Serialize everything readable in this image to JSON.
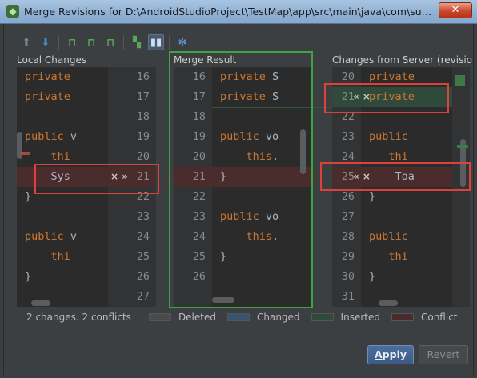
{
  "window": {
    "title": "Merge Revisions for D:\\AndroidStudioProject\\TestMap\\app\\src\\main\\java\\com\\summerxia\\tes...",
    "close_symbol": "✕"
  },
  "toolbar": {
    "icons": [
      "up-arrow-icon",
      "down-arrow-icon",
      "apply-left-icon",
      "apply-all-icon",
      "apply-right-icon",
      "magic-resolve-icon",
      "side-by-side-icon",
      "settings-gear-icon"
    ]
  },
  "panels": {
    "left_header": "Local Changes",
    "center_header": "Merge Result",
    "right_header": "Changes from Server (revisio..."
  },
  "left": {
    "line_numbers": [
      "16",
      "17",
      "18",
      "19",
      "20",
      "21",
      "22",
      "23",
      "24",
      "25",
      "26",
      "27"
    ],
    "code": [
      {
        "kw": "private",
        "txt": ""
      },
      {
        "kw": "private",
        "txt": ""
      },
      {
        "kw": "",
        "txt": ""
      },
      {
        "kw": "public",
        "txt": " v"
      },
      {
        "kw": "    thi",
        "txt": ""
      },
      {
        "kw": "",
        "txt": "    Sys"
      },
      {
        "kw": "",
        "txt": "}"
      },
      {
        "kw": "",
        "txt": ""
      },
      {
        "kw": "public",
        "txt": " v"
      },
      {
        "kw": "    thi",
        "txt": ""
      },
      {
        "kw": "",
        "txt": "}"
      },
      {
        "kw": "",
        "txt": ""
      }
    ],
    "conflict_actions": "× »"
  },
  "center": {
    "line_numbers": [
      "16",
      "17",
      "18",
      "19",
      "20",
      "21",
      "22",
      "23",
      "24",
      "25",
      "26"
    ],
    "code": [
      {
        "kw": "private",
        "txt": " S"
      },
      {
        "kw": "private",
        "txt": " S"
      },
      {
        "kw": "",
        "txt": ""
      },
      {
        "kw": "public",
        "txt": " vo"
      },
      {
        "kw": "    this",
        "txt": "."
      },
      {
        "kw": "",
        "txt": "}"
      },
      {
        "kw": "",
        "txt": ""
      },
      {
        "kw": "public",
        "txt": " vo"
      },
      {
        "kw": "    this",
        "txt": "."
      },
      {
        "kw": "",
        "txt": "}"
      },
      {
        "kw": "",
        "txt": ""
      }
    ]
  },
  "right": {
    "line_numbers": [
      "20",
      "21",
      "22",
      "23",
      "24",
      "25",
      "26",
      "27",
      "28",
      "29",
      "30",
      "31"
    ],
    "code": [
      {
        "kw": "private",
        "txt": ""
      },
      {
        "kw": "private",
        "txt": ""
      },
      {
        "kw": "",
        "txt": ""
      },
      {
        "kw": "public",
        "txt": ""
      },
      {
        "kw": "   thi",
        "txt": ""
      },
      {
        "kw": "",
        "txt": "    Toa"
      },
      {
        "kw": "",
        "txt": "}"
      },
      {
        "kw": "",
        "txt": ""
      },
      {
        "kw": "public",
        "txt": ""
      },
      {
        "kw": "   thi",
        "txt": ""
      },
      {
        "kw": "",
        "txt": "}"
      },
      {
        "kw": "",
        "txt": ""
      }
    ],
    "insert_actions": "« ×",
    "conflict_actions": "« ×"
  },
  "status": {
    "summary": "2 changes. 2 conflicts",
    "legend": [
      {
        "label": "Deleted",
        "color": "#4a4a4a"
      },
      {
        "label": "Changed",
        "color": "#385570"
      },
      {
        "label": "Inserted",
        "color": "#2f4a3a"
      },
      {
        "label": "Conflict",
        "color": "#4a2c2c"
      }
    ]
  },
  "buttons": {
    "apply_first": "A",
    "apply_rest": "pply",
    "revert": "Revert"
  }
}
